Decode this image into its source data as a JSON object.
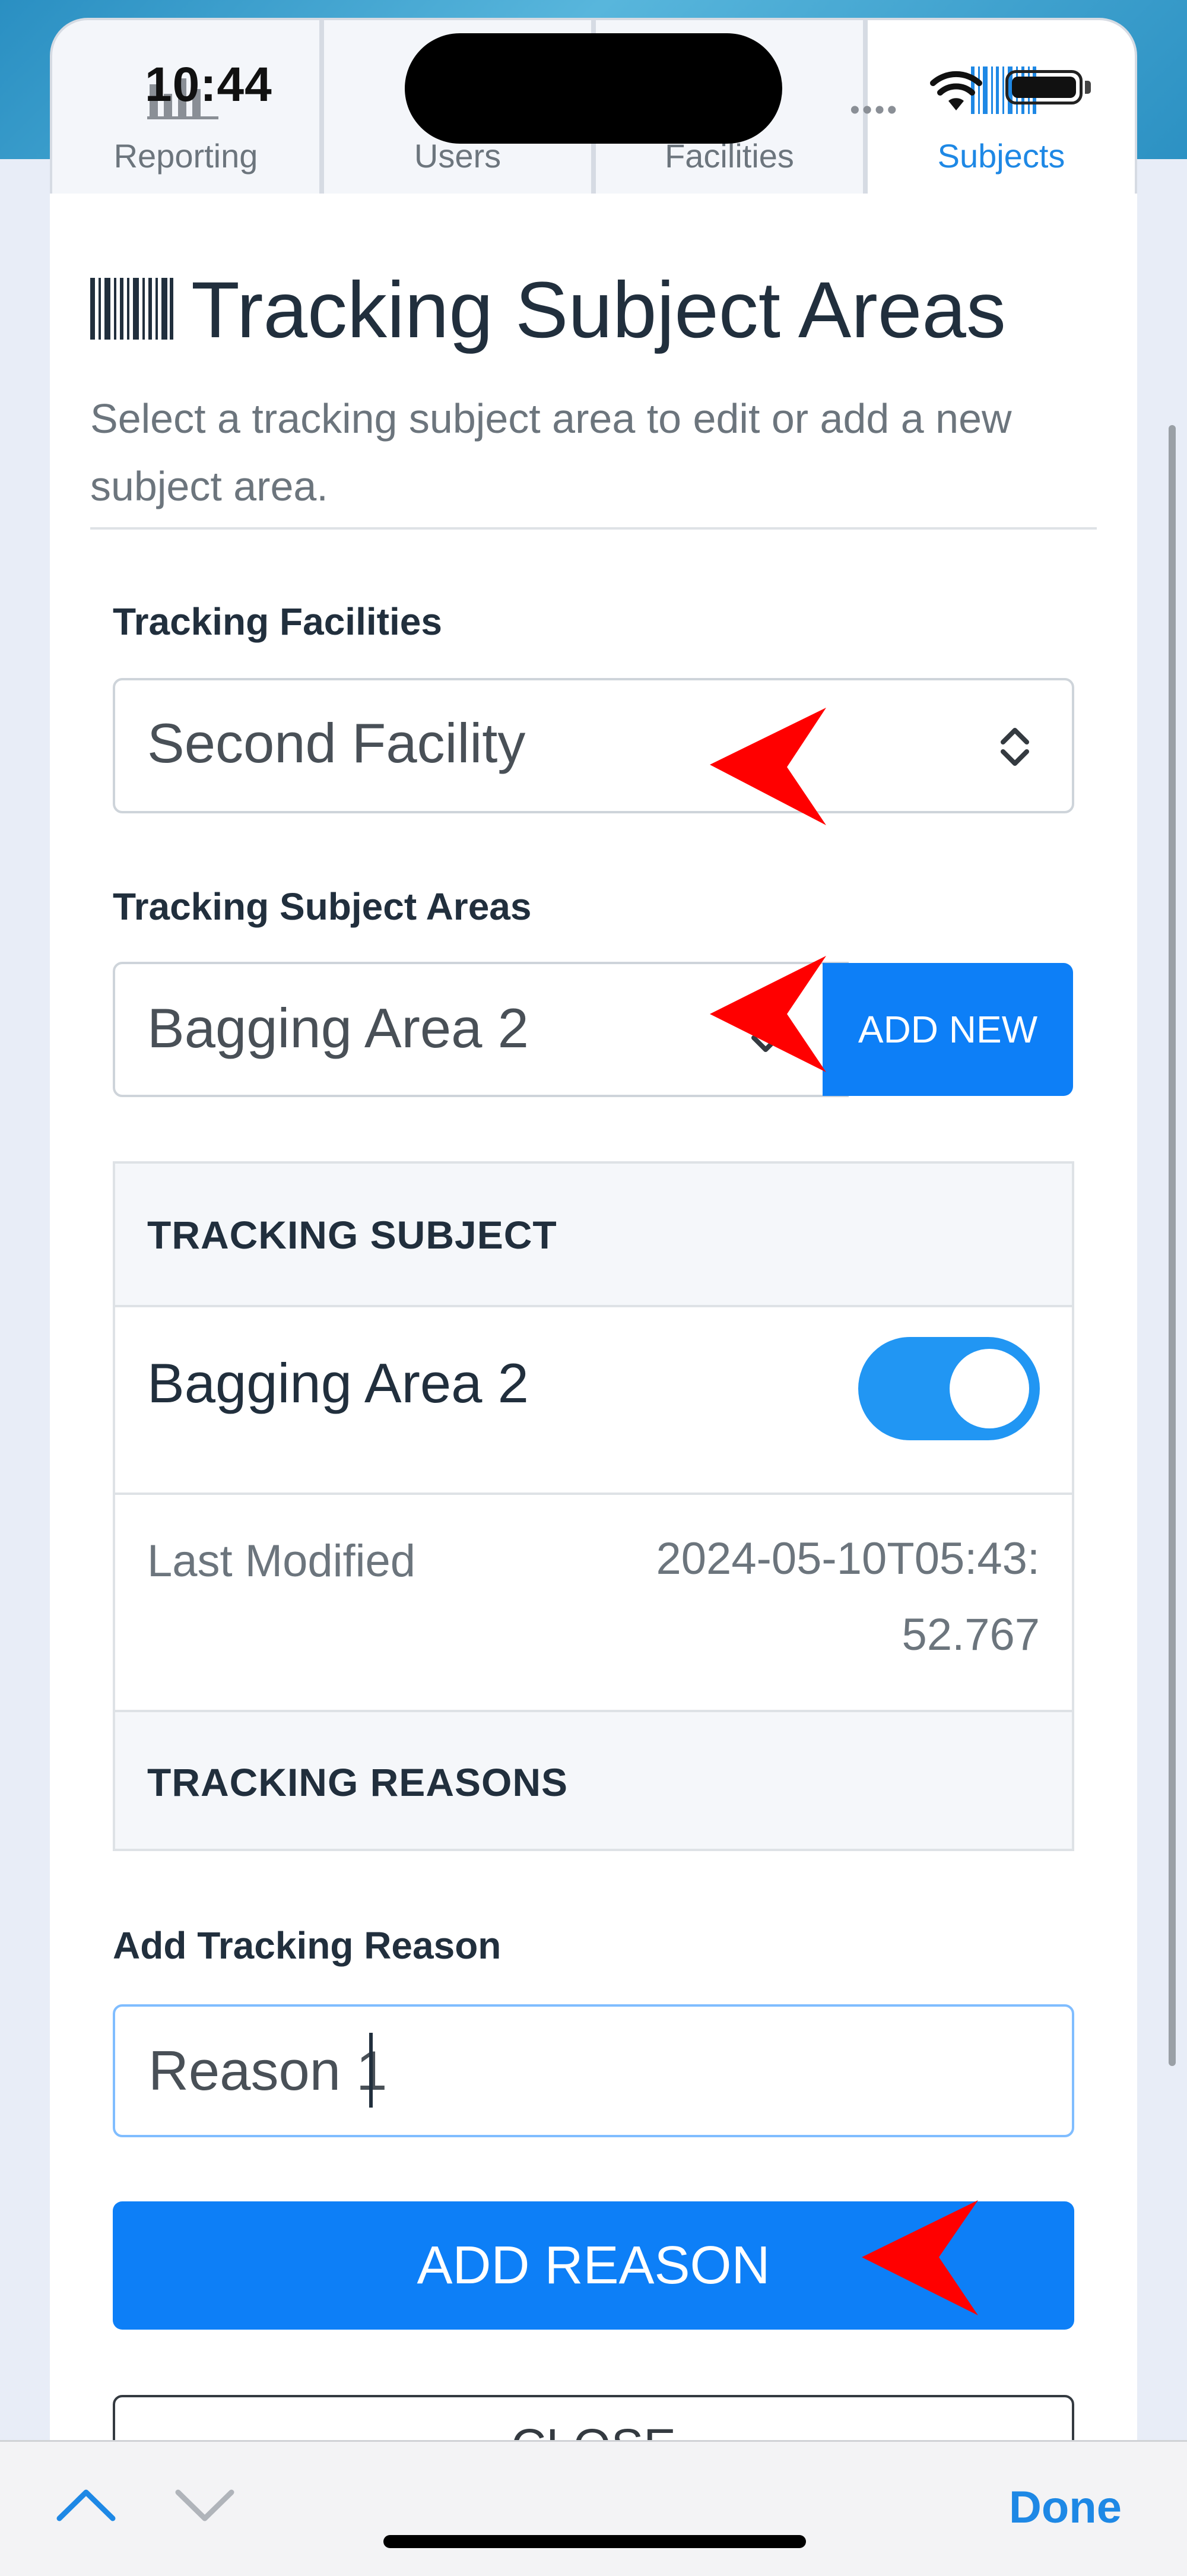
{
  "status_bar": {
    "time": "10:44"
  },
  "tabs": [
    {
      "label": "Reporting",
      "icon": "bar-chart-icon",
      "active": false
    },
    {
      "label": "Users",
      "active": false
    },
    {
      "label": "Facilities",
      "active": false
    },
    {
      "label": "Subjects",
      "icon": "barcode-icon",
      "active": true
    }
  ],
  "page": {
    "title": "Tracking Subject Areas",
    "title_icon": "barcode-icon",
    "subtitle": "Select a tracking subject area to edit or add a new subject area."
  },
  "facilities": {
    "label": "Tracking Facilities",
    "selected": "Second Facility"
  },
  "subject_areas": {
    "label": "Tracking Subject Areas",
    "selected": "Bagging Area 2",
    "add_new_label": "ADD NEW"
  },
  "table": {
    "header": "TRACKING SUBJECT",
    "subject_name": "Bagging Area 2",
    "enabled": true,
    "last_modified_label": "Last Modified",
    "last_modified_value": "2024-05-10T05:43:52.767",
    "reasons_header": "TRACKING REASONS"
  },
  "reason_form": {
    "label": "Add Tracking Reason",
    "value": "Reason 1",
    "submit_label": "ADD REASON",
    "close_label": "CLOSE"
  },
  "keyboard_bar": {
    "done_label": "Done"
  },
  "colors": {
    "accent": "#0d7ff7",
    "toggle_on": "#2196f3",
    "annotation_arrow": "#ff0000"
  }
}
